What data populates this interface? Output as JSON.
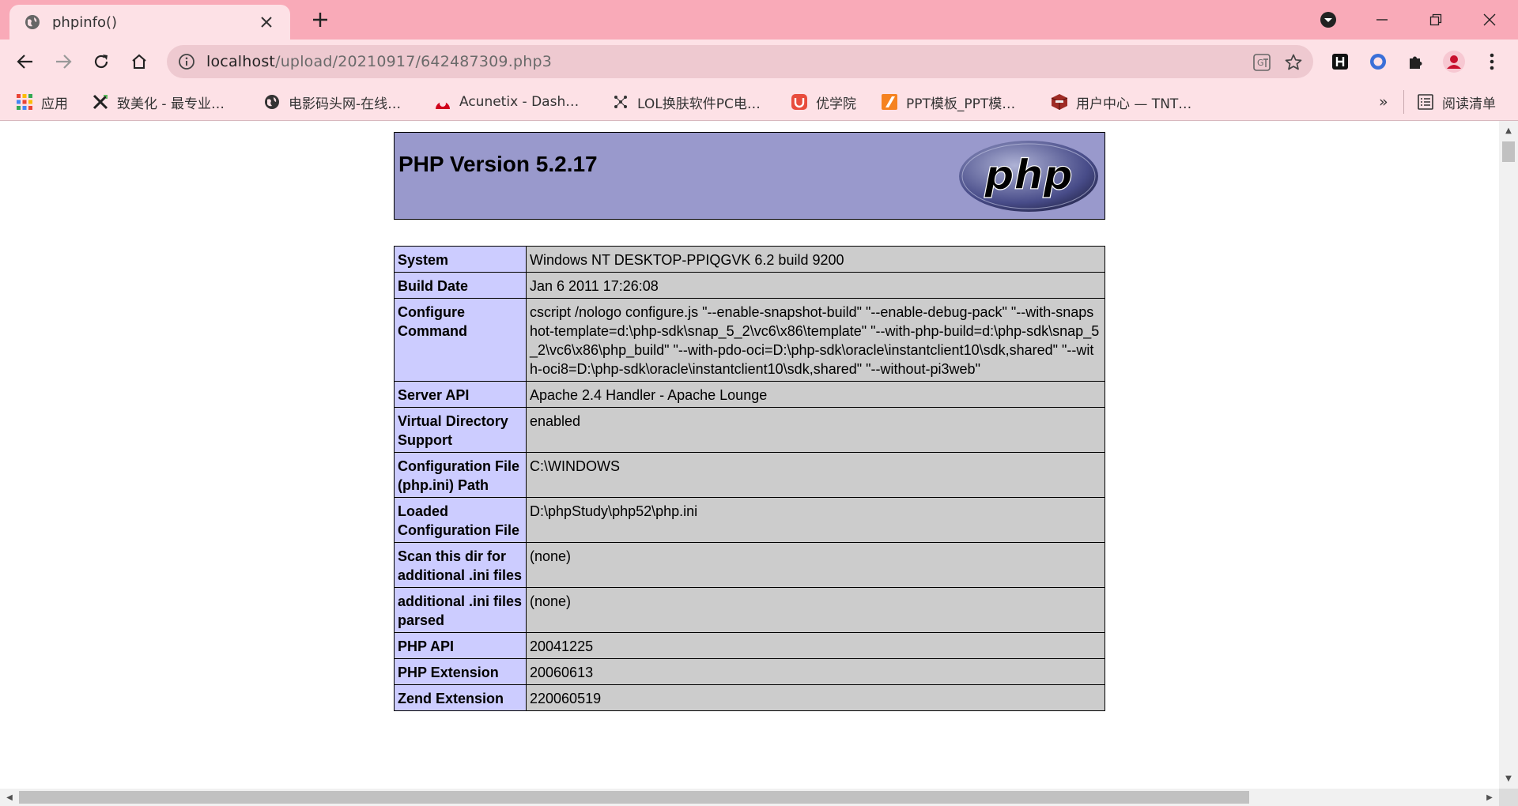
{
  "tab": {
    "title": "phpinfo()"
  },
  "address_bar": {
    "host": "localhost",
    "path": "/upload/20210917/642487309.php3"
  },
  "bookmarks": [
    {
      "label": "应用",
      "icon": "apps-grid-icon"
    },
    {
      "label": "致美化 - 最专业…",
      "icon": "zhimeihua-icon"
    },
    {
      "label": "电影码头网-在线…",
      "icon": "globe-icon"
    },
    {
      "label": "Acunetix - Dash…",
      "icon": "acunetix-icon"
    },
    {
      "label": "LOL换肤软件PC电…",
      "icon": "lol-icon"
    },
    {
      "label": "优学院",
      "icon": "youxueyuan-icon"
    },
    {
      "label": "PPT模板_PPT模…",
      "icon": "ppt-icon"
    },
    {
      "label": "用户中心 — TNT…",
      "icon": "tnt-icon"
    }
  ],
  "bookmarks_overflow": "»",
  "reading_list": "阅读清单",
  "page": {
    "title": "PHP Version 5.2.17",
    "logo_text": "php",
    "rows": [
      {
        "key": "System",
        "value": "Windows NT DESKTOP-PPIQGVK 6.2 build 9200"
      },
      {
        "key": "Build Date",
        "value": "Jan 6 2011 17:26:08"
      },
      {
        "key": "Configure Command",
        "value": "cscript /nologo configure.js \"--enable-snapshot-build\" \"--enable-debug-pack\" \"--with-snapshot-template=d:\\php-sdk\\snap_5_2\\vc6\\x86\\template\" \"--with-php-build=d:\\php-sdk\\snap_5_2\\vc6\\x86\\php_build\" \"--with-pdo-oci=D:\\php-sdk\\oracle\\instantclient10\\sdk,shared\" \"--with-oci8=D:\\php-sdk\\oracle\\instantclient10\\sdk,shared\" \"--without-pi3web\""
      },
      {
        "key": "Server API",
        "value": "Apache 2.4 Handler - Apache Lounge"
      },
      {
        "key": "Virtual Directory Support",
        "value": "enabled"
      },
      {
        "key": "Configuration File (php.ini) Path",
        "value": "C:\\WINDOWS"
      },
      {
        "key": "Loaded Configuration File",
        "value": "D:\\phpStudy\\php52\\php.ini"
      },
      {
        "key": "Scan this dir for additional .ini files",
        "value": "(none)"
      },
      {
        "key": "additional .ini files parsed",
        "value": "(none)"
      },
      {
        "key": "PHP API",
        "value": "20041225"
      },
      {
        "key": "PHP Extension",
        "value": "20060613"
      },
      {
        "key": "Zend Extension",
        "value": "220060519"
      }
    ]
  }
}
